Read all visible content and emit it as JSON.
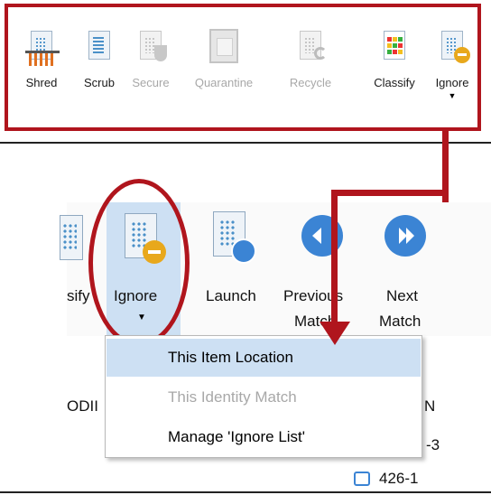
{
  "top_ribbon": {
    "buttons": [
      {
        "label": "Shred",
        "enabled": true,
        "icon": "shred-icon"
      },
      {
        "label": "Scrub",
        "enabled": true,
        "icon": "scrub-icon"
      },
      {
        "label": "Secure",
        "enabled": false,
        "icon": "secure-shield-icon"
      },
      {
        "label": "Quarantine",
        "enabled": false,
        "icon": "quarantine-icon"
      },
      {
        "label": "Recycle",
        "enabled": false,
        "icon": "recycle-icon"
      },
      {
        "label": "Classify",
        "enabled": true,
        "icon": "classify-icon"
      },
      {
        "label": "Ignore",
        "enabled": true,
        "icon": "ignore-icon"
      }
    ]
  },
  "zoom_ribbon": {
    "classify_partial": "sify",
    "ignore_label": "Ignore",
    "launch_label": "Launch",
    "previous_label_1": "Previous",
    "previous_label_2": "Match",
    "next_label_1": "Next",
    "next_label_2": "Match"
  },
  "dropdown": {
    "items": [
      {
        "label": "This Item Location",
        "enabled": true,
        "hover": true
      },
      {
        "label": "This Identity Match",
        "enabled": false,
        "hover": false
      },
      {
        "label": "Manage 'Ignore List'",
        "enabled": true,
        "hover": false
      }
    ]
  },
  "table": {
    "header_partial": "ODII",
    "right_header_partial": "N",
    "row_partial_1": "-3",
    "row_partial_2": "426-1"
  },
  "colors": {
    "highlight_red": "#b0151d",
    "selected_blue": "#cde0f3",
    "icon_blue": "#3b84d4"
  }
}
